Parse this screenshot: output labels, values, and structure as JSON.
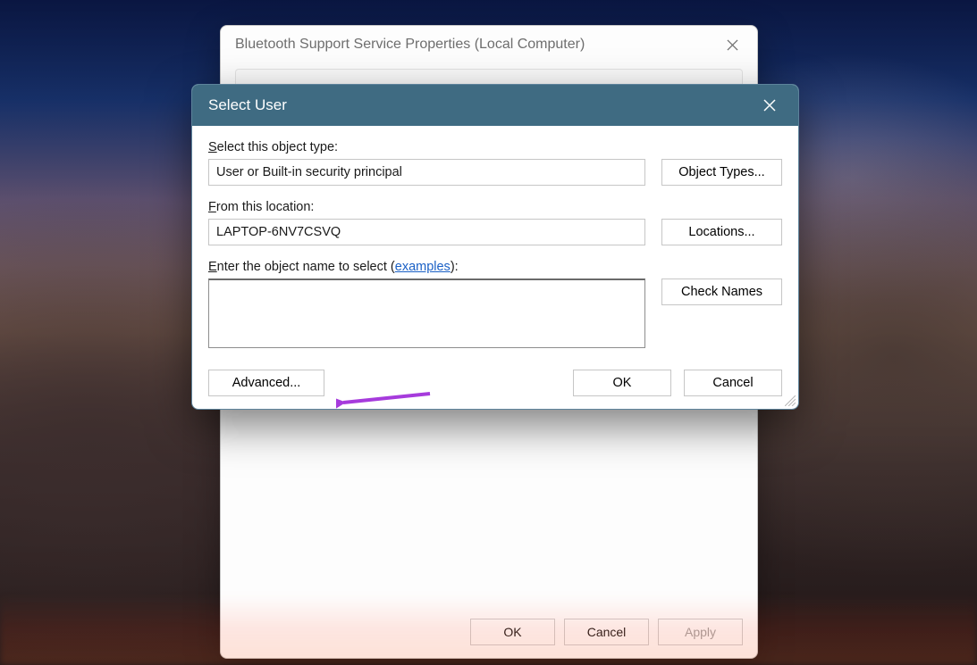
{
  "backWindow": {
    "title": "Bluetooth Support Service Properties (Local Computer)",
    "buttons": {
      "ok": "OK",
      "cancel": "Cancel",
      "apply": "Apply"
    }
  },
  "frontWindow": {
    "title": "Select User",
    "objectType": {
      "label_pre": "S",
      "label_post": "elect this object type:",
      "value": "User or Built-in security principal",
      "button": "Object Types..."
    },
    "location": {
      "label_pre": "F",
      "label_post": "rom this location:",
      "value": "LAPTOP-6NV7CSVQ",
      "button": "Locations..."
    },
    "objectName": {
      "label_pre": "E",
      "label_mid": "nter the object name to select (",
      "examples": "examples",
      "label_post": "):",
      "value": "",
      "button": "Check Names"
    },
    "buttons": {
      "advanced": "Advanced...",
      "ok": "OK",
      "cancel": "Cancel"
    }
  },
  "annotation": {
    "arrow_color": "#a63bdc"
  }
}
